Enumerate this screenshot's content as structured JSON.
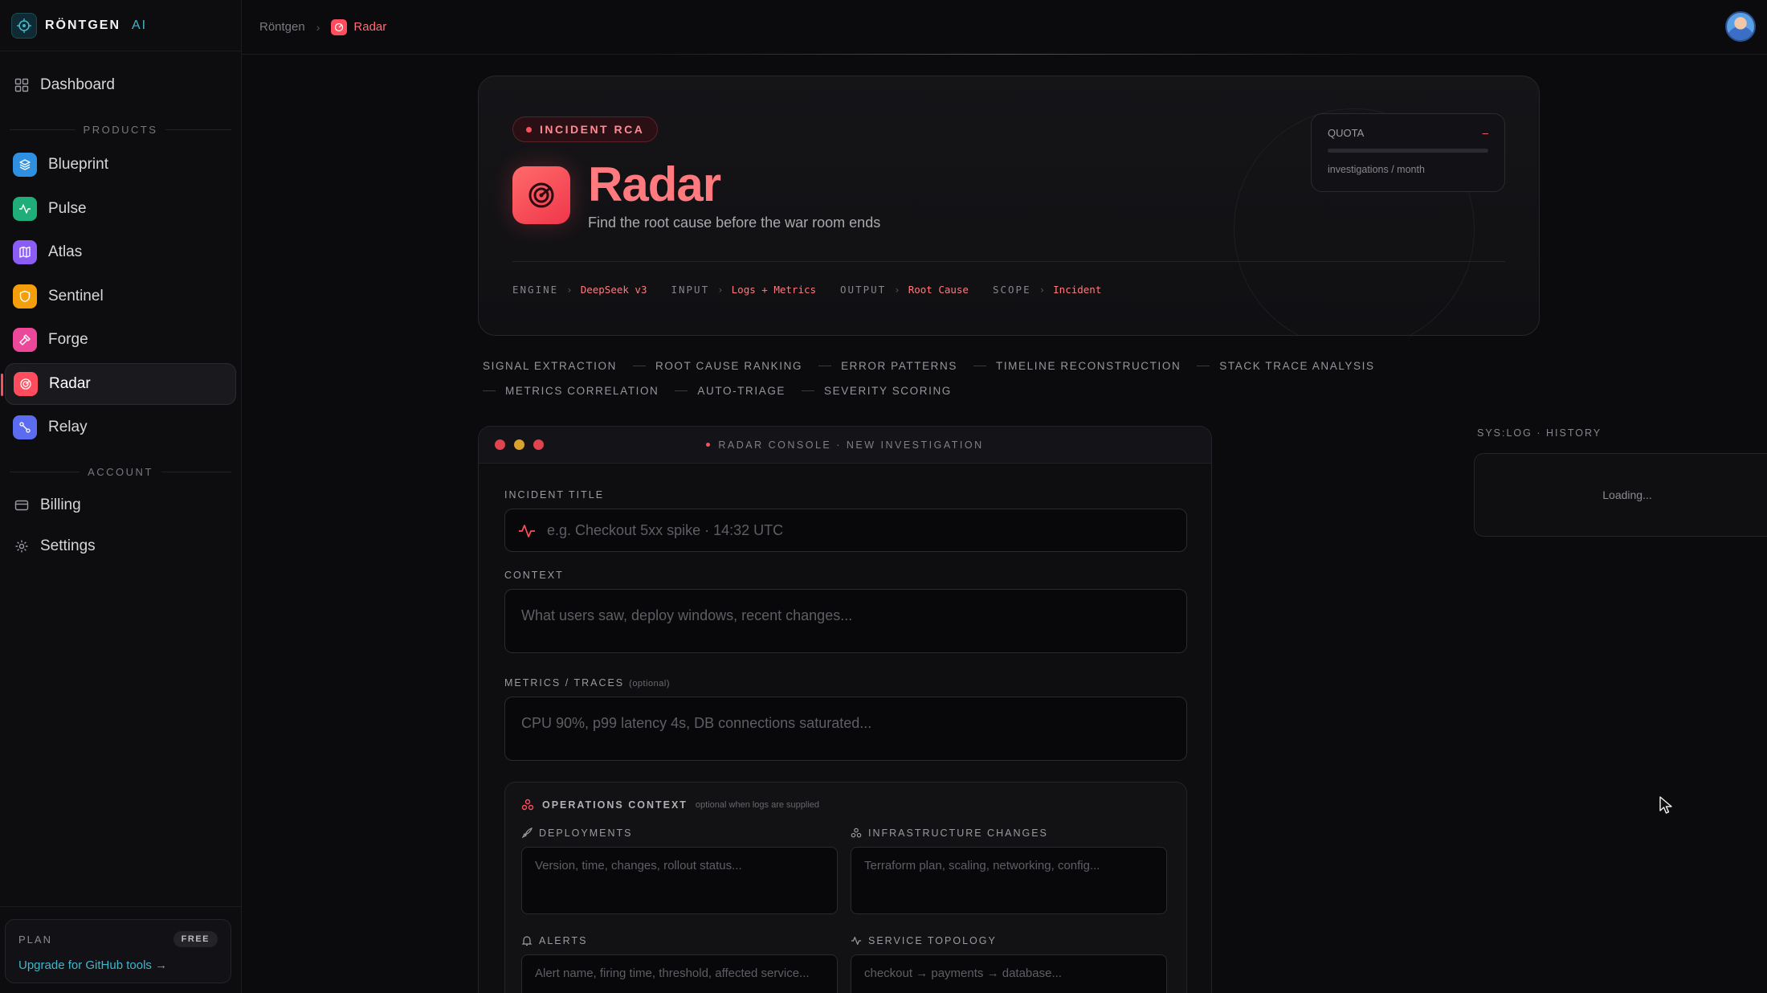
{
  "brand": {
    "name": "RÖNTGEN",
    "suffix": "AI"
  },
  "nav": {
    "dashboard": "Dashboard",
    "products_label": "PRODUCTS",
    "products": [
      {
        "label": "Blueprint",
        "color": "#2f8fe0",
        "icon": "layers-icon"
      },
      {
        "label": "Pulse",
        "color": "#1fae7a",
        "icon": "activity-icon"
      },
      {
        "label": "Atlas",
        "color": "#8b5cf6",
        "icon": "map-icon"
      },
      {
        "label": "Sentinel",
        "color": "#f59e0b",
        "icon": "shield-icon"
      },
      {
        "label": "Forge",
        "color": "#ec4899",
        "icon": "hammer-icon"
      },
      {
        "label": "Radar",
        "color": "#ff4d5e",
        "icon": "radar-icon"
      },
      {
        "label": "Relay",
        "color": "#5b6cf0",
        "icon": "route-icon"
      }
    ],
    "account_label": "ACCOUNT",
    "billing": "Billing",
    "settings": "Settings"
  },
  "plan": {
    "label": "PLAN",
    "badge": "FREE",
    "upgrade": "Upgrade for GitHub tools →"
  },
  "breadcrumb": {
    "root": "Röntgen",
    "current": "Radar"
  },
  "hero": {
    "badge": "INCIDENT RCA",
    "title": "Radar",
    "subtitle": "Find the root cause before the war room ends",
    "specs": [
      {
        "key": "ENGINE",
        "value": "DeepSeek v3"
      },
      {
        "key": "INPUT",
        "value": "Logs + Metrics"
      },
      {
        "key": "OUTPUT",
        "value": "Root Cause"
      },
      {
        "key": "SCOPE",
        "value": "Incident"
      }
    ],
    "quota": {
      "label": "QUOTA",
      "value": "–",
      "caption": "investigations / month"
    }
  },
  "capabilities": [
    "SIGNAL EXTRACTION",
    "ROOT CAUSE RANKING",
    "ERROR PATTERNS",
    "TIMELINE RECONSTRUCTION",
    "STACK TRACE ANALYSIS",
    "METRICS CORRELATION",
    "AUTO-TRIAGE",
    "SEVERITY SCORING"
  ],
  "console": {
    "title": "RADAR CONSOLE · NEW INVESTIGATION",
    "incident_title_label": "INCIDENT TITLE",
    "incident_title_placeholder": "e.g. Checkout 5xx spike · 14:32 UTC",
    "context_label": "CONTEXT",
    "context_placeholder": "What users saw, deploy windows, recent changes...",
    "metrics_label": "METRICS / TRACES",
    "metrics_optional": "(optional)",
    "metrics_placeholder": "CPU 90%, p99 latency 4s, DB connections saturated...",
    "ops": {
      "title": "OPERATIONS CONTEXT",
      "hint": "optional when logs are supplied",
      "deployments_label": "DEPLOYMENTS",
      "deployments_placeholder": "Version, time, changes, rollout status...",
      "infra_label": "INFRASTRUCTURE CHANGES",
      "infra_placeholder": "Terraform plan, scaling, networking, config...",
      "alerts_label": "ALERTS",
      "alerts_placeholder": "Alert name, firing time, threshold, affected service...",
      "topology_label": "SERVICE TOPOLOGY",
      "topology_placeholder": "checkout → payments → database..."
    }
  },
  "history": {
    "label": "SYS:LOG · HISTORY",
    "loading": "Loading..."
  }
}
